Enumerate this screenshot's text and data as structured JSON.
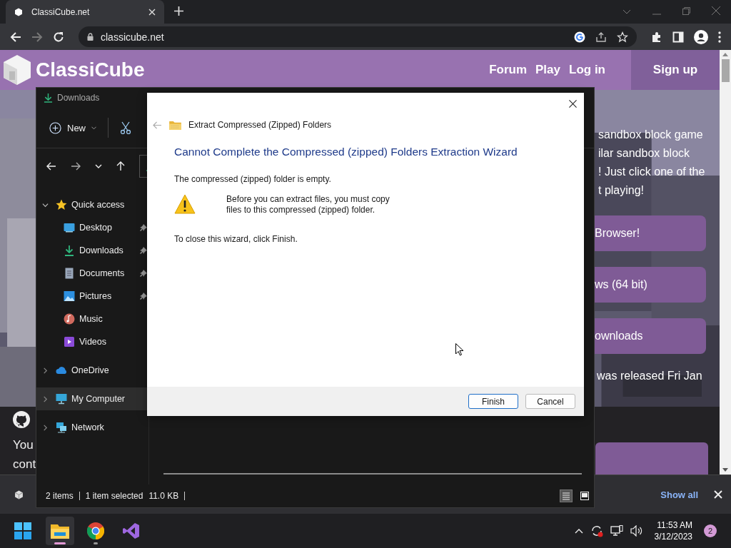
{
  "browser": {
    "tabs": [
      {
        "title": "ClassiCube.net",
        "selected": true
      }
    ],
    "address": "classicube.net"
  },
  "site": {
    "logo": "ClassiCube",
    "nav": [
      {
        "label": "Forum"
      },
      {
        "label": "Play"
      },
      {
        "label": "Log in"
      }
    ],
    "signup": "Sign up",
    "intro_lines": [
      "sandbox block game",
      "ilar sandbox block",
      "! Just click one of the",
      "t playing!"
    ],
    "buttons": [
      "Browser!",
      "ws (64 bit)",
      "ownloads"
    ],
    "release_line": "was released Fri Jan",
    "footer_lines": [
      "You",
      "cont"
    ]
  },
  "download_bar": {
    "show_all": "Show all"
  },
  "explorer": {
    "title": "Downloads",
    "new_label": "New",
    "tree": [
      {
        "label": "Quick access",
        "kind": "star",
        "expanded": true,
        "selected": false,
        "children": [
          {
            "label": "Desktop",
            "kind": "desktop",
            "pinned": true,
            "selected": false
          },
          {
            "label": "Downloads",
            "kind": "download",
            "pinned": true,
            "selected": false
          },
          {
            "label": "Documents",
            "kind": "document",
            "pinned": true,
            "selected": false
          },
          {
            "label": "Pictures",
            "kind": "pictures",
            "pinned": true,
            "selected": false
          },
          {
            "label": "Music",
            "kind": "music",
            "pinned": false,
            "selected": false
          },
          {
            "label": "Videos",
            "kind": "videos",
            "pinned": false,
            "selected": false
          }
        ]
      },
      {
        "label": "OneDrive",
        "kind": "cloud",
        "expanded": false,
        "selected": false
      },
      {
        "label": "My Computer",
        "kind": "computer",
        "expanded": false,
        "selected": true
      },
      {
        "label": "Network",
        "kind": "network",
        "expanded": false,
        "selected": false
      }
    ],
    "status": [
      "2 items",
      "1 item selected",
      "11.0 KB"
    ],
    "views": [
      {
        "kind": "details",
        "selected": true
      },
      {
        "kind": "tiles",
        "selected": false
      }
    ]
  },
  "dialog": {
    "title": "Extract Compressed (Zipped) Folders",
    "heading": "Cannot Complete the Compressed (zipped) Folders Extraction Wizard",
    "message": "The compressed (zipped) folder is empty.",
    "warning_lines": [
      "Before you can extract files, you must copy",
      "files to this compressed (zipped) folder."
    ],
    "closing": "To close this wizard, click Finish.",
    "buttons": [
      {
        "label": "Finish",
        "default": true
      },
      {
        "label": "Cancel",
        "default": false
      }
    ]
  },
  "taskbar": {
    "apps": [
      {
        "kind": "explorer",
        "selected": true,
        "running": true
      },
      {
        "kind": "chrome",
        "selected": false,
        "running": true
      },
      {
        "kind": "studio",
        "selected": false,
        "running": false
      }
    ],
    "time": "11:53 AM",
    "date": "3/12/2023",
    "notifications": "2"
  }
}
